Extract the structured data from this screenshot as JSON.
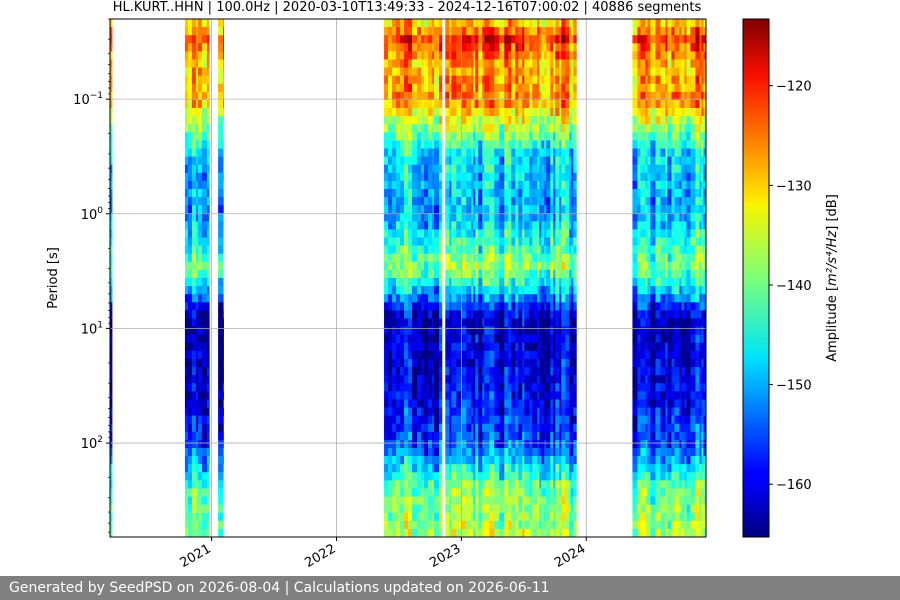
{
  "chart_data": {
    "type": "heatmap",
    "title": "HL.KURT..HHN | 100.0Hz | 2020-03-10T13:49:33 - 2024-12-16T07:00:02 | 40886 segments",
    "xlabel": "",
    "ylabel": "Period [s]",
    "x_axis": {
      "type": "time",
      "range": [
        "2020-03-10",
        "2024-12-16"
      ],
      "ticks": [
        "2021",
        "2022",
        "2023",
        "2024"
      ],
      "tick_dates": [
        "2021-01-01",
        "2022-01-01",
        "2023-01-01",
        "2024-01-01"
      ]
    },
    "y_axis": {
      "scale": "log",
      "inverted": true,
      "range_seconds": [
        0.02,
        660
      ],
      "ticks": [
        {
          "value": 0.1,
          "base": "10",
          "exp": "−1"
        },
        {
          "value": 1,
          "base": "10",
          "exp": "0"
        },
        {
          "value": 10,
          "base": "10",
          "exp": "1"
        },
        {
          "value": 100,
          "base": "10",
          "exp": "2"
        }
      ]
    },
    "colorbar": {
      "label_prefix": "Amplitude [",
      "label_math": "m²/s⁴/Hz",
      "label_suffix": "] [dB]",
      "range_db": [
        -165.3,
        -113.3
      ],
      "ticks": [
        -120,
        -130,
        -140,
        -150,
        -160
      ],
      "tick_labels": [
        "−120",
        "−130",
        "−140",
        "−150",
        "−160"
      ],
      "colormap": "jet"
    },
    "grid": true,
    "data_periods": [
      {
        "start": "2020-03-10",
        "end": "2020-03-13"
      },
      {
        "start": "2020-10-15",
        "end": "2020-12-25"
      },
      {
        "start": "2021-01-20",
        "end": "2021-02-05"
      },
      {
        "start": "2022-05-20",
        "end": "2022-11-05"
      },
      {
        "start": "2022-11-15",
        "end": "2023-12-03"
      },
      {
        "start": "2024-05-15",
        "end": "2024-12-16"
      }
    ],
    "spectrum_profile_db": [
      {
        "period_s": 0.02,
        "db": -132
      },
      {
        "period_s": 0.03,
        "db": -122
      },
      {
        "period_s": 0.05,
        "db": -129
      },
      {
        "period_s": 0.1,
        "db": -127
      },
      {
        "period_s": 0.3,
        "db": -147
      },
      {
        "period_s": 1,
        "db": -150
      },
      {
        "period_s": 3,
        "db": -138
      },
      {
        "period_s": 5,
        "db": -150
      },
      {
        "period_s": 8,
        "db": -162
      },
      {
        "period_s": 30,
        "db": -160
      },
      {
        "period_s": 100,
        "db": -155
      },
      {
        "period_s": 250,
        "db": -140
      },
      {
        "period_s": 660,
        "db": -137
      }
    ]
  },
  "footer": {
    "text": "Generated by SeedPSD on 2026-08-04 | Calculations updated on 2026-06-11"
  },
  "colors": {
    "footer_bg": "#808080",
    "footer_text": "#ffffff",
    "grid": "#b0b0b0"
  }
}
